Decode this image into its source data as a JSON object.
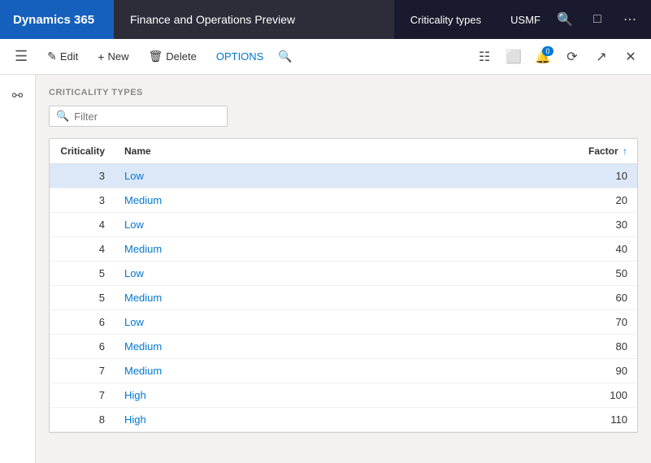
{
  "topbar": {
    "dynamics_label": "Dynamics 365",
    "app_title": "Finance and Operations Preview",
    "module": "Criticality types",
    "company": "USMF"
  },
  "toolbar": {
    "edit_label": "Edit",
    "new_label": "New",
    "delete_label": "Delete",
    "options_label": "OPTIONS",
    "notification_badge": "0"
  },
  "content": {
    "section_title": "CRITICALITY TYPES",
    "filter_placeholder": "Filter"
  },
  "table": {
    "columns": [
      {
        "id": "criticality",
        "label": "Criticality"
      },
      {
        "id": "name",
        "label": "Name"
      },
      {
        "id": "factor",
        "label": "Factor"
      }
    ],
    "rows": [
      {
        "criticality": "3",
        "name": "Low",
        "factor": "10",
        "selected": true
      },
      {
        "criticality": "3",
        "name": "Medium",
        "factor": "20",
        "selected": false
      },
      {
        "criticality": "4",
        "name": "Low",
        "factor": "30",
        "selected": false
      },
      {
        "criticality": "4",
        "name": "Medium",
        "factor": "40",
        "selected": false
      },
      {
        "criticality": "5",
        "name": "Low",
        "factor": "50",
        "selected": false
      },
      {
        "criticality": "5",
        "name": "Medium",
        "factor": "60",
        "selected": false
      },
      {
        "criticality": "6",
        "name": "Low",
        "factor": "70",
        "selected": false
      },
      {
        "criticality": "6",
        "name": "Medium",
        "factor": "80",
        "selected": false
      },
      {
        "criticality": "7",
        "name": "Medium",
        "factor": "90",
        "selected": false
      },
      {
        "criticality": "7",
        "name": "High",
        "factor": "100",
        "selected": false
      },
      {
        "criticality": "8",
        "name": "High",
        "factor": "110",
        "selected": false
      }
    ]
  }
}
